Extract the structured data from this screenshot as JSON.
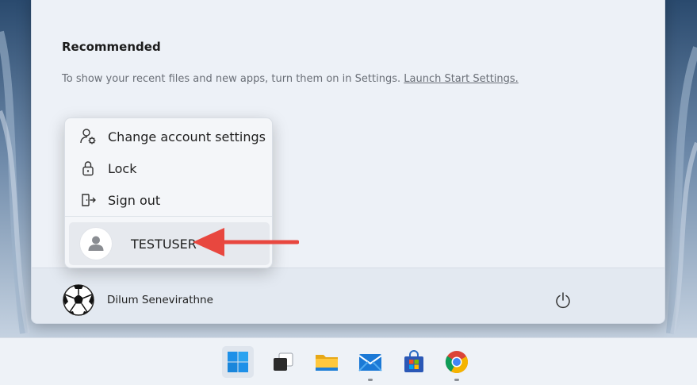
{
  "start_menu": {
    "recommended_title": "Recommended",
    "recommended_text": "To show your recent files and new apps, turn them on in Settings.",
    "recommended_link": "Launch Start Settings."
  },
  "account_menu": {
    "items": [
      {
        "label": "Change account settings",
        "icon": "person-gear-icon"
      },
      {
        "label": "Lock",
        "icon": "lock-icon"
      },
      {
        "label": "Sign out",
        "icon": "sign-out-icon"
      }
    ],
    "other_user": {
      "label": "TESTUSER",
      "icon": "person-icon"
    }
  },
  "footer": {
    "user_name": "Dilum Senevirathne",
    "avatar_icon": "soccer-ball-icon",
    "power_icon": "power-icon"
  },
  "annotation": {
    "arrow_color": "#e8473f"
  },
  "taskbar": {
    "apps": [
      {
        "name": "start-icon"
      },
      {
        "name": "task-view-icon"
      },
      {
        "name": "file-explorer-icon"
      },
      {
        "name": "mail-icon"
      },
      {
        "name": "microsoft-store-icon"
      },
      {
        "name": "chrome-icon"
      }
    ]
  }
}
